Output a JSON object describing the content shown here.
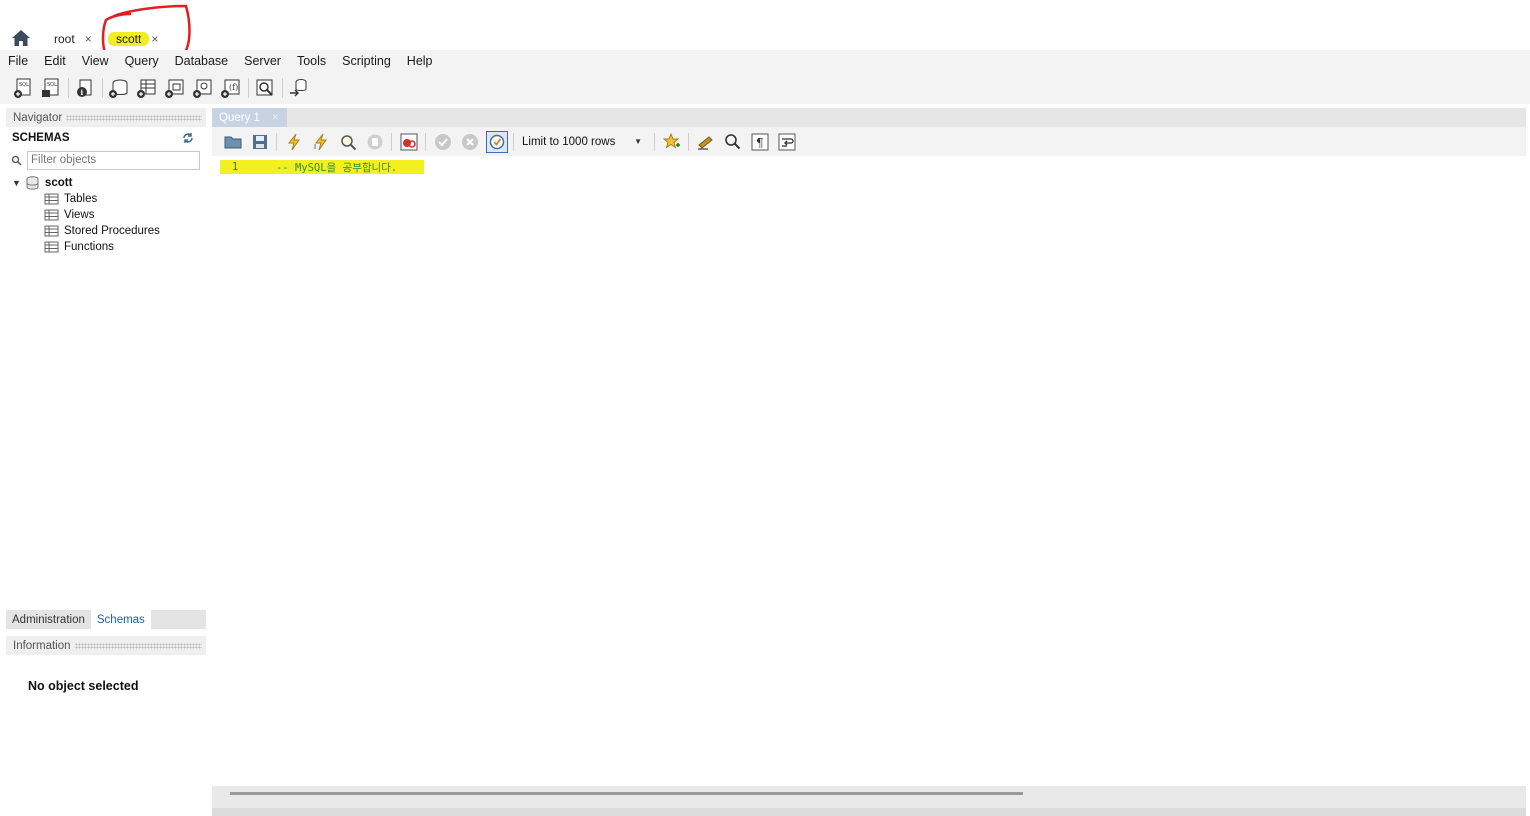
{
  "connection_tabs": {
    "home_icon": "home-icon",
    "tabs": [
      {
        "label": "root",
        "close": "×"
      },
      {
        "label": "scott",
        "close": "×"
      }
    ]
  },
  "menu": [
    "File",
    "Edit",
    "View",
    "Query",
    "Database",
    "Server",
    "Tools",
    "Scripting",
    "Help"
  ],
  "navigator": {
    "header": "Navigator",
    "schemas_label": "SCHEMAS",
    "filter_placeholder": "Filter objects",
    "schema": {
      "name": "scott",
      "children": [
        "Tables",
        "Views",
        "Stored Procedures",
        "Functions"
      ]
    },
    "bottom_tabs": [
      "Administration",
      "Schemas"
    ],
    "info_header": "Information",
    "info_text": "No object selected"
  },
  "query": {
    "tab_label": "Query 1",
    "tab_close": "×",
    "limit_label": "Limit to 1000 rows",
    "lines": [
      {
        "number": "1",
        "text": "-- MySQL을 공부합니다."
      }
    ]
  },
  "colors": {
    "highlight": "#f2f020",
    "annotation_circle": "#e02020",
    "comment_text": "#3b8a2c",
    "active_tab": "#1d5f9e"
  }
}
